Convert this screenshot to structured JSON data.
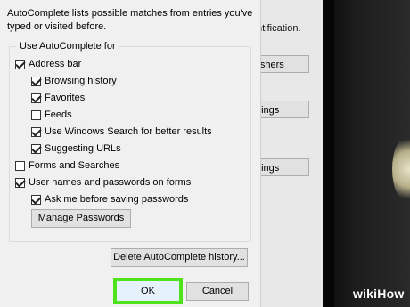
{
  "background_window": {
    "text": "ntification.",
    "buttons": [
      "lishers",
      "ttings",
      "ttings"
    ]
  },
  "dialog": {
    "intro": "AutoComplete lists possible matches from entries you've typed or visited before.",
    "group_title": "Use AutoComplete for",
    "options": {
      "address_bar": {
        "label": "Address bar",
        "checked": true
      },
      "browsing_history": {
        "label": "Browsing history",
        "checked": true
      },
      "favorites": {
        "label": "Favorites",
        "checked": true
      },
      "feeds": {
        "label": "Feeds",
        "checked": false
      },
      "windows_search": {
        "label": "Use Windows Search for better results",
        "checked": true
      },
      "suggesting_urls": {
        "label": "Suggesting URLs",
        "checked": true
      },
      "forms_searches": {
        "label": "Forms and Searches",
        "checked": false
      },
      "user_names": {
        "label": "User names and passwords on forms",
        "checked": true
      },
      "ask_before_saving": {
        "label": "Ask me before saving passwords",
        "checked": true
      }
    },
    "manage_passwords": "Manage Passwords",
    "delete_history": "Delete AutoComplete history...",
    "ok": "OK",
    "cancel": "Cancel"
  },
  "watermark": {
    "wiki": "wiki",
    "how": "How"
  },
  "colors": {
    "highlight": "#4ee31a",
    "dialog_bg": "#f0f0f0"
  }
}
